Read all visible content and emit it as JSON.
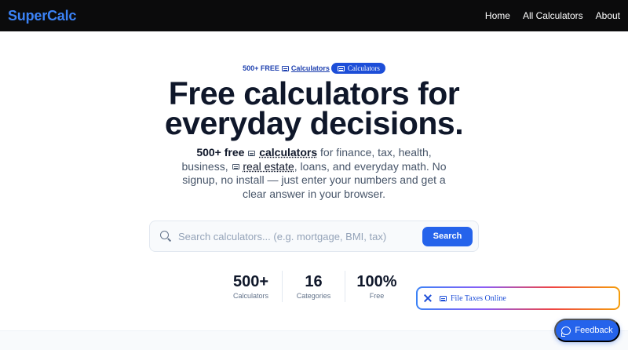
{
  "brand": {
    "name": "SuperCalc",
    "color": "#3b82f6"
  },
  "nav": [
    {
      "label": "Home"
    },
    {
      "label": "All Calculators"
    },
    {
      "label": "About"
    }
  ],
  "hero": {
    "eyebrow_prefix": "500+ FREE",
    "eyebrow_link": "Calculators",
    "eyebrow_pill": "Calculators",
    "title_line1": "Free calculators for",
    "title_line2": "everyday decisions.",
    "subtitle": {
      "bold": "500+ free",
      "link_calculators": "calculators",
      "text1": " for finance, tax, health, business, ",
      "link_real_estate": "real estate",
      "text2": ", loans, and everyday math. No signup, no install — just enter your numbers and get a clear answer in your browser."
    },
    "icon": "calculator-icon"
  },
  "search": {
    "placeholder": "Search calculators... (e.g. mortgage, BMI, tax)",
    "value": "",
    "button_label": "Search",
    "icon": "search-icon"
  },
  "stats": [
    {
      "value": "500+",
      "label": "Calculators"
    },
    {
      "value": "16",
      "label": "Categories"
    },
    {
      "value": "100%",
      "label": "Free"
    }
  ],
  "tax_banner": {
    "label": "File Taxes Online",
    "close_icon": "close-icon",
    "icon": "calculator-icon"
  },
  "feedback": {
    "label": "Feedback",
    "icon": "chat-bubble-icon"
  },
  "colors": {
    "nav_bg": "#0b0b0c",
    "accent": "#2563eb",
    "pill": "#1d4ed8",
    "heading": "#0f172a"
  }
}
